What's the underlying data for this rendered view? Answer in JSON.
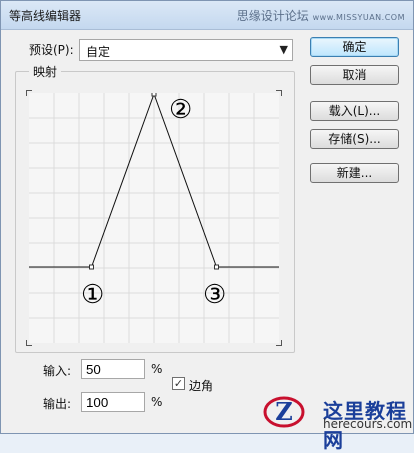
{
  "window": {
    "title": "等高线编辑器",
    "watermark": "思缘设计论坛",
    "watermark_site": "www.MISSYUAN.COM"
  },
  "preset": {
    "label": "预设(P):",
    "value": "自定"
  },
  "mapping": {
    "group_label": "映射",
    "curve_points": [
      [
        0,
        0
      ],
      [
        25,
        0
      ],
      [
        50,
        100
      ],
      [
        75,
        0
      ],
      [
        100,
        0
      ]
    ],
    "markers": [
      "①",
      "②",
      "③"
    ]
  },
  "buttons": {
    "ok": "确定",
    "cancel": "取消",
    "load": "载入(L)...",
    "save": "存储(S)...",
    "new": "新建..."
  },
  "fields": {
    "input_label": "输入:",
    "input_value": "50",
    "output_label": "输出:",
    "output_value": "100",
    "percent": "%",
    "edge_label": "边角",
    "edge_checked": true
  },
  "site_logo": {
    "cn": "这里教程网",
    "en": "herecours.com"
  },
  "colors": {
    "accent": "#3c7fb1",
    "logo_blue": "#1b3f9a",
    "logo_red": "#c8102e"
  }
}
